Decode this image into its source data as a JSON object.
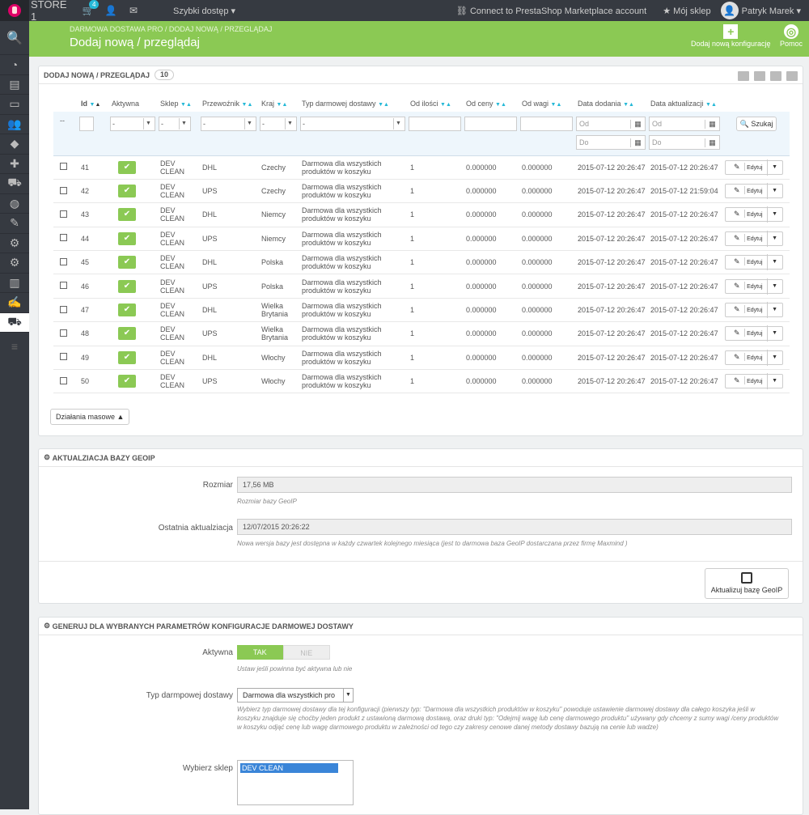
{
  "topbar": {
    "store": "STORE 1",
    "cart_count": "4",
    "quick_access": "Szybki dostęp",
    "marketplace": "Connect to PrestaShop Marketplace account",
    "my_shop": "Mój sklep",
    "user": "Patryk Marek"
  },
  "header": {
    "breadcrumb": "DARMOWA DOSTAWA PRO  /  DODAJ NOWĄ / PRZEGLĄDAJ",
    "title": "Dodaj nową / przeglądaj",
    "add_config": "Dodaj nową konfigurację",
    "help": "Pomoc"
  },
  "list": {
    "title": "DODAJ NOWĄ / PRZEGLĄDAJ",
    "count": "10",
    "columns": [
      "Id",
      "Aktywna",
      "Sklep",
      "Przewoźnik",
      "Kraj",
      "Typ darmowej dostawy",
      "Od ilości",
      "Od ceny",
      "Od wagi",
      "Data dodania",
      "Data aktualizacji"
    ],
    "filter": {
      "dash": "--",
      "select": "-",
      "od": "Od",
      "do": "Do",
      "search": "Szukaj"
    },
    "rows": [
      {
        "id": "41",
        "shop": "DEV CLEAN",
        "carrier": "DHL",
        "country": "Czechy",
        "type": "Darmowa dla wszystkich produktów w koszyku",
        "qty": "1",
        "price": "0.000000",
        "weight": "0.000000",
        "added": "2015-07-12 20:26:47",
        "updated": "2015-07-12 20:26:47"
      },
      {
        "id": "42",
        "shop": "DEV CLEAN",
        "carrier": "UPS",
        "country": "Czechy",
        "type": "Darmowa dla wszystkich produktów w koszyku",
        "qty": "1",
        "price": "0.000000",
        "weight": "0.000000",
        "added": "2015-07-12 20:26:47",
        "updated": "2015-07-12 21:59:04"
      },
      {
        "id": "43",
        "shop": "DEV CLEAN",
        "carrier": "DHL",
        "country": "Niemcy",
        "type": "Darmowa dla wszystkich produktów w koszyku",
        "qty": "1",
        "price": "0.000000",
        "weight": "0.000000",
        "added": "2015-07-12 20:26:47",
        "updated": "2015-07-12 20:26:47"
      },
      {
        "id": "44",
        "shop": "DEV CLEAN",
        "carrier": "UPS",
        "country": "Niemcy",
        "type": "Darmowa dla wszystkich produktów w koszyku",
        "qty": "1",
        "price": "0.000000",
        "weight": "0.000000",
        "added": "2015-07-12 20:26:47",
        "updated": "2015-07-12 20:26:47"
      },
      {
        "id": "45",
        "shop": "DEV CLEAN",
        "carrier": "DHL",
        "country": "Polska",
        "type": "Darmowa dla wszystkich produktów w koszyku",
        "qty": "1",
        "price": "0.000000",
        "weight": "0.000000",
        "added": "2015-07-12 20:26:47",
        "updated": "2015-07-12 20:26:47"
      },
      {
        "id": "46",
        "shop": "DEV CLEAN",
        "carrier": "UPS",
        "country": "Polska",
        "type": "Darmowa dla wszystkich produktów w koszyku",
        "qty": "1",
        "price": "0.000000",
        "weight": "0.000000",
        "added": "2015-07-12 20:26:47",
        "updated": "2015-07-12 20:26:47"
      },
      {
        "id": "47",
        "shop": "DEV CLEAN",
        "carrier": "DHL",
        "country": "Wielka Brytania",
        "type": "Darmowa dla wszystkich produktów w koszyku",
        "qty": "1",
        "price": "0.000000",
        "weight": "0.000000",
        "added": "2015-07-12 20:26:47",
        "updated": "2015-07-12 20:26:47"
      },
      {
        "id": "48",
        "shop": "DEV CLEAN",
        "carrier": "UPS",
        "country": "Wielka Brytania",
        "type": "Darmowa dla wszystkich produktów w koszyku",
        "qty": "1",
        "price": "0.000000",
        "weight": "0.000000",
        "added": "2015-07-12 20:26:47",
        "updated": "2015-07-12 20:26:47"
      },
      {
        "id": "49",
        "shop": "DEV CLEAN",
        "carrier": "DHL",
        "country": "Włochy",
        "type": "Darmowa dla wszystkich produktów w koszyku",
        "qty": "1",
        "price": "0.000000",
        "weight": "0.000000",
        "added": "2015-07-12 20:26:47",
        "updated": "2015-07-12 20:26:47"
      },
      {
        "id": "50",
        "shop": "DEV CLEAN",
        "carrier": "UPS",
        "country": "Włochy",
        "type": "Darmowa dla wszystkich produktów w koszyku",
        "qty": "1",
        "price": "0.000000",
        "weight": "0.000000",
        "added": "2015-07-12 20:26:47",
        "updated": "2015-07-12 20:26:47"
      }
    ],
    "edit": "Edytuj",
    "bulk": "Działania masowe"
  },
  "geoip": {
    "title": "AKTUALZIACJA BAZY GEOIP",
    "size_label": "Rozmiar",
    "size_value": "17,56 MB",
    "size_help": "Rozmiar bazy GeoIP",
    "last_label": "Ostatnia aktualziacja",
    "last_value": "12/07/2015 20:26:22",
    "last_help": "Nowa wersja bazy jest dostępna w każdy czwartek kolejnego miesiąca (jest to darmowa baza GeoIP dostarczana przez firmę Maxmind )",
    "button": "Aktualizuj bazę GeoIP"
  },
  "generate": {
    "title": "GENERUJ DLA WYBRANYCH PARAMETRÓW KONFIGURACJE DARMOWEJ DOSTAWY",
    "active_label": "Aktywna",
    "yes": "TAK",
    "no": "NIE",
    "active_help": "Ustaw jeśli powinna być aktywna lub nie",
    "type_label": "Typ darmpowej dostawy",
    "type_value": "Darmowa dla wszystkich pro",
    "type_help": "Wybierz typ darmowej dostawy dla tej konfiguracji (pierwszy typ: \"Darmowa dla wszystkich produktów w koszyku\" powoduje ustawienie darmowej dostawy dla całego koszyka jeśli w koszyku znajduje się choćby jeden produkt z ustawioną darmową dostawą, oraz druki typ: \"Odejmij wagę lub cenę darmowego produktu\" używany gdy chcemy z sumy wagi /ceny produktów w koszyku odjąć cenę lub wagę darmowego produktu w zależności od tego czy zakresy cenowe danej metody dostawy bazują na cenie lub wadze)",
    "shop_label": "Wybierz sklep",
    "shop_option": "DEV CLEAN"
  }
}
